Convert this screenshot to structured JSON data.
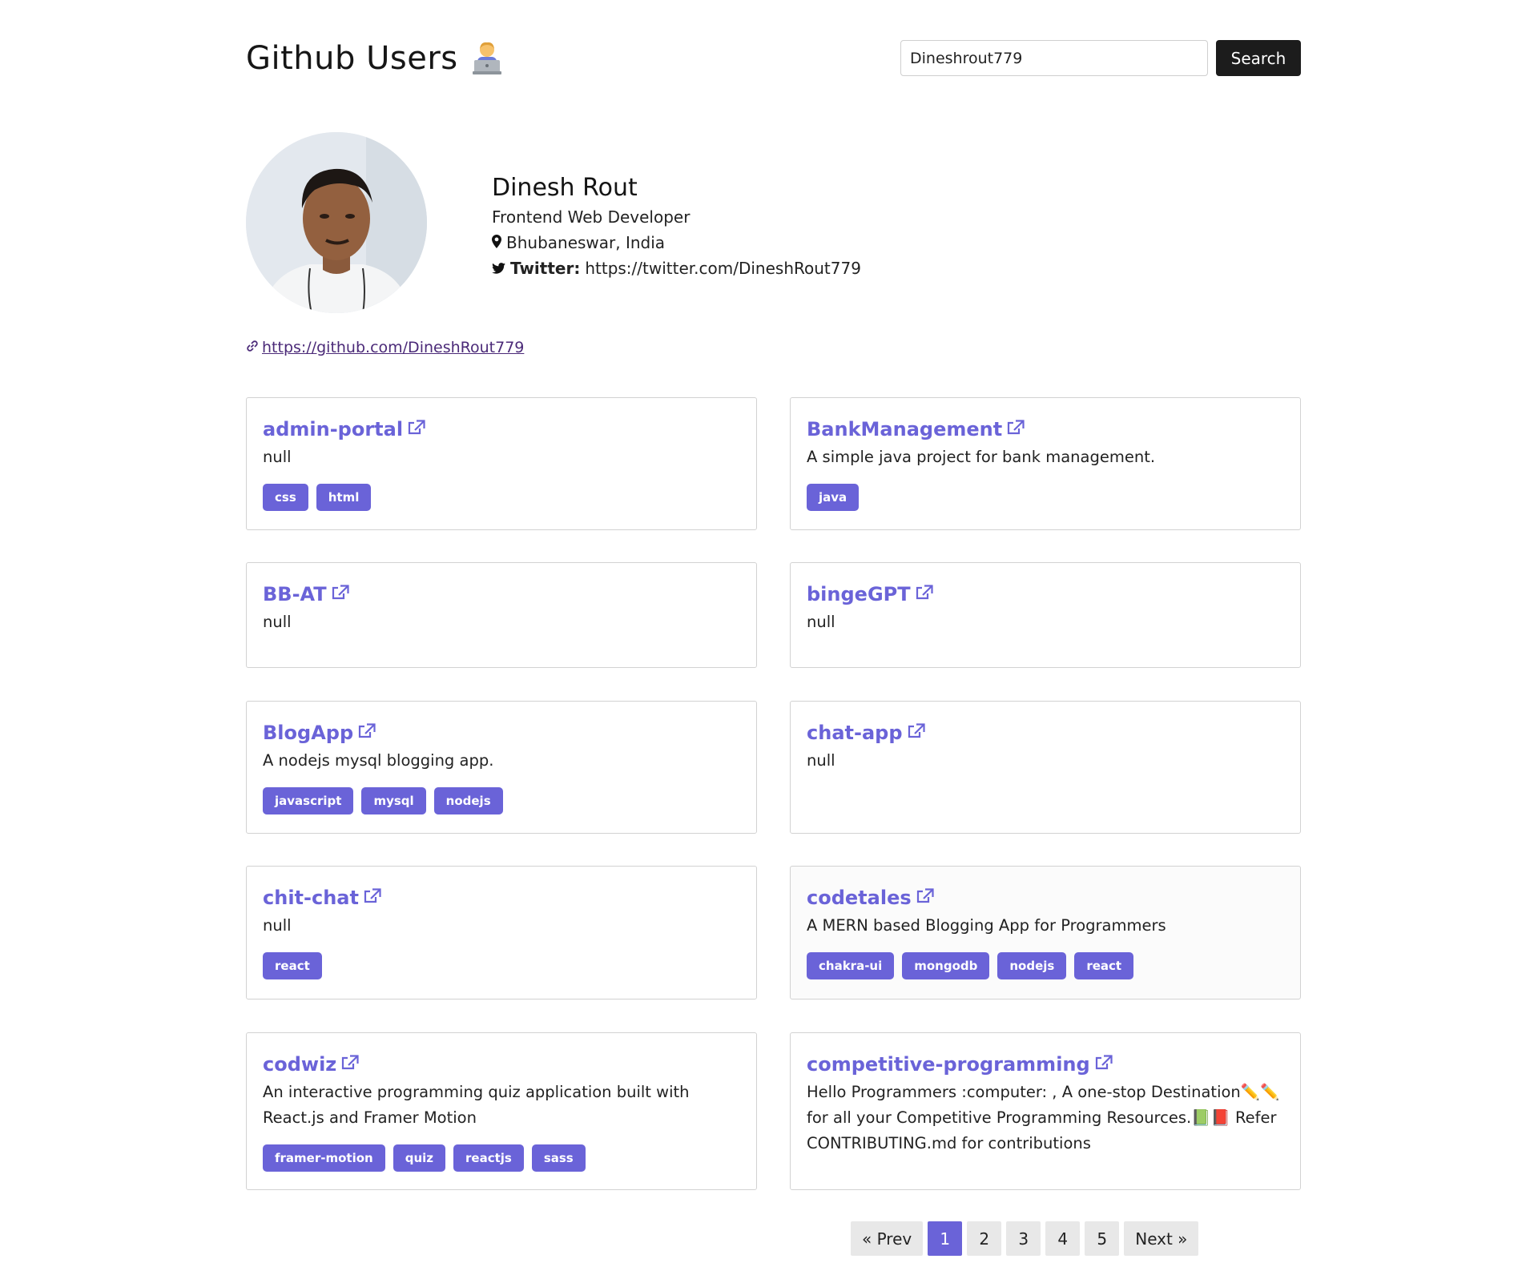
{
  "header": {
    "title": "Github Users",
    "emoji_icon": "technologist-emoji"
  },
  "search": {
    "value": "Dineshrout779",
    "placeholder": "",
    "button_label": "Search"
  },
  "profile": {
    "name": "Dinesh Rout",
    "bio": "Frontend Web Developer",
    "location": "Bhubaneswar, India",
    "twitter_label": "Twitter:",
    "twitter_url": "https://twitter.com/DineshRout779",
    "github_url": "https://github.com/DineshRout779"
  },
  "repos": [
    {
      "name": "admin-portal",
      "description": "null",
      "tags": [
        "css",
        "html"
      ]
    },
    {
      "name": "BankManagement",
      "description": "A simple java project for bank management.",
      "tags": [
        "java"
      ]
    },
    {
      "name": "BB-AT",
      "description": "null",
      "tags": []
    },
    {
      "name": "bingeGPT",
      "description": "null",
      "tags": []
    },
    {
      "name": "BlogApp",
      "description": "A nodejs mysql blogging app.",
      "tags": [
        "javascript",
        "mysql",
        "nodejs"
      ]
    },
    {
      "name": "chat-app",
      "description": "null",
      "tags": []
    },
    {
      "name": "chit-chat",
      "description": "null",
      "tags": [
        "react"
      ]
    },
    {
      "name": "codetales",
      "description": "A MERN based Blogging App for Programmers",
      "tags": [
        "chakra-ui",
        "mongodb",
        "nodejs",
        "react"
      ]
    },
    {
      "name": "codwiz",
      "description": "An interactive programming quiz application built with React.js and Framer Motion",
      "tags": [
        "framer-motion",
        "quiz",
        "reactjs",
        "sass"
      ]
    },
    {
      "name": "competitive-programming",
      "description": "Hello Programmers :computer: , A one-stop Destination✏️✏️ for all your Competitive Programming Resources.📗📕 Refer CONTRIBUTING.md for contributions",
      "tags": []
    }
  ],
  "pagination": {
    "prev_label": "« Prev",
    "pages": [
      "1",
      "2",
      "3",
      "4",
      "5"
    ],
    "active_page": "1",
    "next_label": "Next »"
  },
  "colors": {
    "accent": "#6a63d8",
    "dark_button": "#1c1c1c",
    "link_visited": "#4b2a78"
  }
}
